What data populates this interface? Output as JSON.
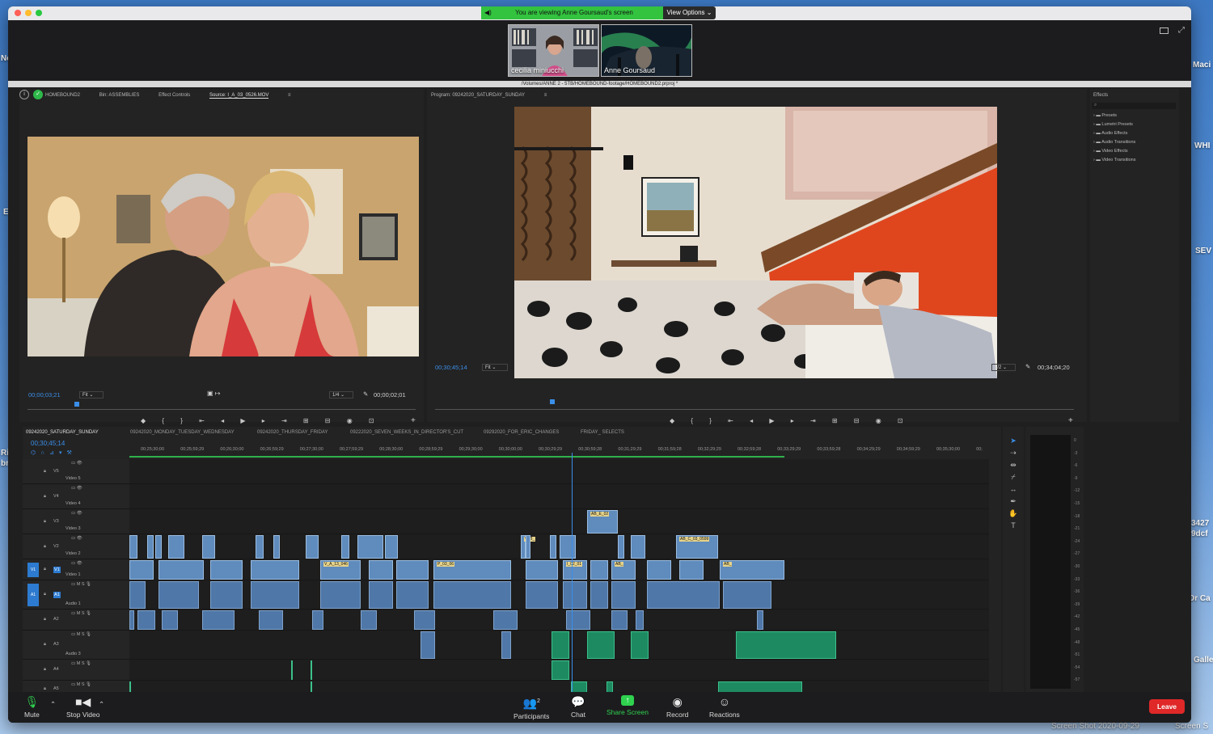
{
  "desktop": {
    "labels": [
      "Ne",
      "Maci",
      "WHI",
      "E",
      "SEV",
      "Ri",
      "br",
      "3427",
      "9dcf",
      "Dr Ca",
      "Galle"
    ],
    "screenshot_labels": [
      "Screen Shot 2020-09-29",
      "Screen S"
    ]
  },
  "zoom": {
    "banner": "You are viewing Anne Goursaud's screen",
    "view_options": "View Options",
    "participants": [
      {
        "name": "cecilia miniucchi"
      },
      {
        "name": "Anne Goursaud"
      }
    ],
    "participants_count": "2",
    "toolbar": {
      "mute": "Mute",
      "stop_video": "Stop Video",
      "participants": "Participants",
      "chat": "Chat",
      "share_screen": "Share Screen",
      "record": "Record",
      "reactions": "Reactions",
      "leave": "Leave"
    },
    "colors": {
      "share_green": "#33c33f",
      "leave_red": "#e02828"
    }
  },
  "premiere": {
    "project_path": "/Volumes/ANNE 2 - 5TB/HOMEBOUND-footage/HOMEBOUND2.prproj *",
    "source_panel": {
      "tabs": [
        "HOMEBOUND2",
        "Bin: ASSEMBLIES",
        "Effect Controls",
        "Source: I_A_03_0526.MOV"
      ],
      "timecode": "00;00;03;21",
      "fit": "Fit",
      "resolution": "1/4",
      "duration": "00;00;02;01"
    },
    "program_panel": {
      "title": "Program: 09242020_SATURDAY_SUNDAY",
      "timecode": "00;30;45;14",
      "fit": "Fit",
      "resolution": "1/2",
      "duration": "00;34;04;20"
    },
    "effects_panel": {
      "title": "Effects",
      "items": [
        "Presets",
        "Lumetri Presets",
        "Audio Effects",
        "Audio Transitions",
        "Video Effects",
        "Video Transitions"
      ]
    },
    "timeline": {
      "tabs": [
        "09242020_SATURDAY_SUNDAY",
        "09242020_MONDAY_TUESDAY_WEDNESDAY",
        "09242020_THURSDAY_FRIDAY",
        "09222020_SEVEN_WEEKS_IN_DIRECTOR'S_CUT",
        "09292020_FOR_ERIC_CHANGES",
        "FRIDAY_ SELECTS"
      ],
      "timecode": "00;30;45;14",
      "ruler": [
        "00;25;30;00",
        "00;25;59;29",
        "00;26;30;00",
        "00;26;59;29",
        "00;27;30;00",
        "00;27;59;29",
        "00;28;30;00",
        "00;28;59;29",
        "00;29;30;00",
        "00;30;00;00",
        "00;30;29;29",
        "00;30;59;28",
        "00;31;29;29",
        "00;31;59;28",
        "00;32;29;29",
        "00;32;59;28",
        "00;33;29;29",
        "00;33;59;28",
        "00;34;29;29",
        "00;34;59;29",
        "00;35;30;00",
        "00;"
      ],
      "tracks": [
        {
          "id": "V5",
          "name": "Video 5"
        },
        {
          "id": "V4",
          "name": "Video 4"
        },
        {
          "id": "V3",
          "name": "Video 3"
        },
        {
          "id": "V2",
          "name": "Video 2"
        },
        {
          "id": "V1",
          "name": "Video 1"
        },
        {
          "id": "A1",
          "name": "Audio 1"
        },
        {
          "id": "A2",
          "name": ""
        },
        {
          "id": "A3",
          "name": "Audio 3"
        },
        {
          "id": "A4",
          "name": ""
        },
        {
          "id": "A5",
          "name": ""
        }
      ],
      "clip_labels": [
        "AB_E_02",
        "V_B_",
        "AB_C_03_0599",
        "V_A_13_046",
        "P_03_06",
        "I_02_01",
        "AB_",
        "AB_"
      ],
      "meter_scale": [
        "0",
        "-3",
        "-6",
        "-9",
        "-12",
        "-15",
        "-18",
        "-21",
        "-24",
        "-27",
        "-30",
        "-33",
        "-36",
        "-39",
        "-42",
        "-45",
        "-48",
        "-51",
        "-54",
        "-57"
      ]
    }
  }
}
